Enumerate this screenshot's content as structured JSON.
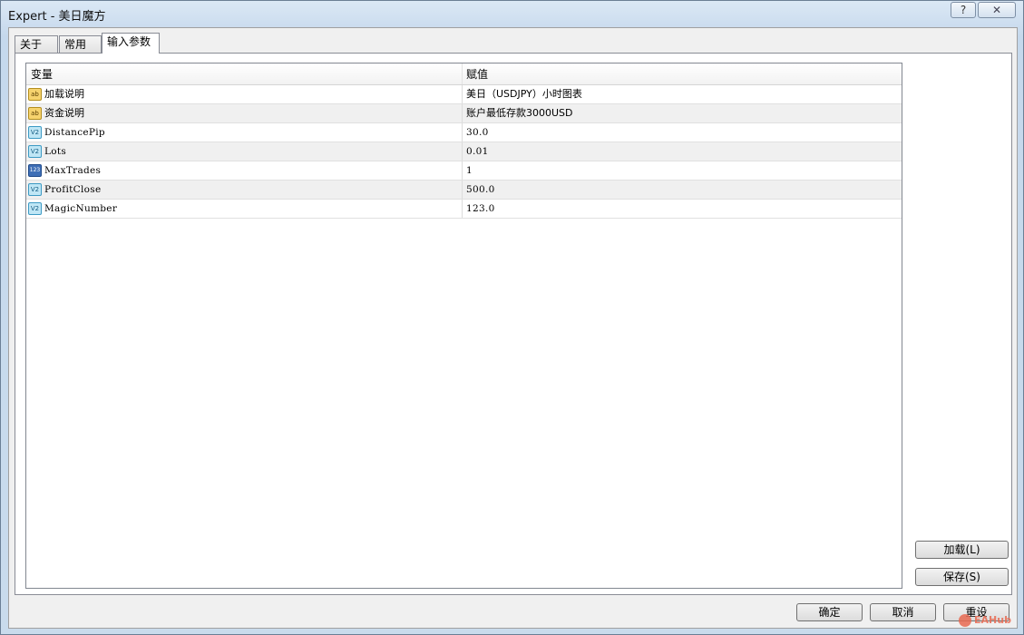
{
  "window": {
    "title": "Expert - 美日魔方",
    "help_label": "?",
    "close_label": "✕"
  },
  "tabs": [
    {
      "label": "关于"
    },
    {
      "label": "常用"
    },
    {
      "label": "输入参数"
    }
  ],
  "table": {
    "headers": {
      "variable": "变量",
      "value": "赋值"
    },
    "rows": [
      {
        "icon": "string-type-icon",
        "badge": "ab",
        "name": "加载说明",
        "value": "美日（USDJPY）小时图表"
      },
      {
        "icon": "string-type-icon",
        "badge": "ab",
        "name": "资金说明",
        "value": "账户最低存款3000USD"
      },
      {
        "icon": "double-type-icon",
        "badge": "V2",
        "name": "DistancePip",
        "value": "30.0"
      },
      {
        "icon": "double-type-icon",
        "badge": "V2",
        "name": "Lots",
        "value": "0.01"
      },
      {
        "icon": "integer-type-icon",
        "badge": "123",
        "name": "MaxTrades",
        "value": "1"
      },
      {
        "icon": "double-type-icon",
        "badge": "V2",
        "name": "ProfitClose",
        "value": "500.0"
      },
      {
        "icon": "double-type-icon",
        "badge": "V2",
        "name": "MagicNumber",
        "value": "123.0"
      }
    ]
  },
  "side_buttons": {
    "load": "加载(L)",
    "save": "保存(S)"
  },
  "footer": {
    "ok": "确定",
    "cancel": "取消",
    "reset": "重设"
  },
  "watermark": "EAHub"
}
